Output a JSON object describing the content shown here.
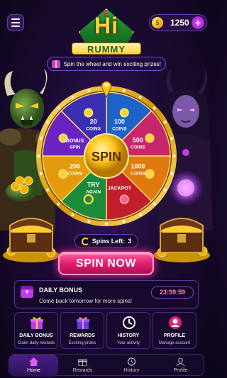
{
  "header": {
    "menu_icon": "hamburger-icon",
    "coins": "1250",
    "coin_icon": "coin-icon",
    "add_icon": "plus-icon"
  },
  "logo": {
    "line1": "Hi",
    "line2": "RUMMY"
  },
  "promo": {
    "text": "Spin the wheel and win exciting prizes!",
    "icon": "gift-icon"
  },
  "wheel": {
    "center_label": "SPIN",
    "segments": [
      {
        "line1": "100",
        "line2": "COINS",
        "color": "#1e63c9",
        "icon": "coin-icon"
      },
      {
        "line1": "500",
        "line2": "COINS",
        "color": "#c7266b",
        "icon": "coin-stack-icon"
      },
      {
        "line1": "1000",
        "line2": "COINS",
        "color": "#e07a0e",
        "icon": "coin-pile-icon"
      },
      {
        "line1": "JACKPOT",
        "line2": "",
        "color": "#c21e2b",
        "icon": "gift-icon"
      },
      {
        "line1": "TRY",
        "line2": "AGAIN",
        "color": "#1b8a3a",
        "icon": "refresh-icon"
      },
      {
        "line1": "200",
        "line2": "COINS",
        "color": "#e39b0d",
        "icon": "coin-icon"
      },
      {
        "line1": "BONUS",
        "line2": "SPIN",
        "color": "#6a23c2",
        "icon": "ticket-icon"
      },
      {
        "line1": "20",
        "line2": "COINS",
        "color": "#3a2fb0",
        "icon": "coin-icon"
      }
    ]
  },
  "spins_left": {
    "label": "Spins Left:",
    "count": "3"
  },
  "spin_now": {
    "label": "SPIN NOW"
  },
  "daily_bonus": {
    "title": "DAILY BONUS",
    "subtitle": "Come back tomorrow for more spins!",
    "timer": "23:59:59"
  },
  "quick_actions": [
    {
      "title": "DAILY BONUS",
      "sub": "Claim daily rewards",
      "icon": "gift-icon"
    },
    {
      "title": "REWARDS",
      "sub": "Exciting prizes",
      "icon": "gift-box-icon"
    },
    {
      "title": "HISTORY",
      "sub": "Your activity",
      "icon": "clock-icon"
    },
    {
      "title": "PROFILE",
      "sub": "Manage account",
      "icon": "user-icon"
    }
  ],
  "nav": [
    {
      "label": "Home",
      "icon": "home-icon",
      "active": true
    },
    {
      "label": "Rewards",
      "icon": "gift-icon",
      "active": false
    },
    {
      "label": "History",
      "icon": "clock-icon",
      "active": false
    },
    {
      "label": "Profile",
      "icon": "user-icon",
      "active": false
    }
  ],
  "colors": {
    "accent": "#ff2d8d",
    "gold": "#ffd23b",
    "panel": "#16092d"
  }
}
